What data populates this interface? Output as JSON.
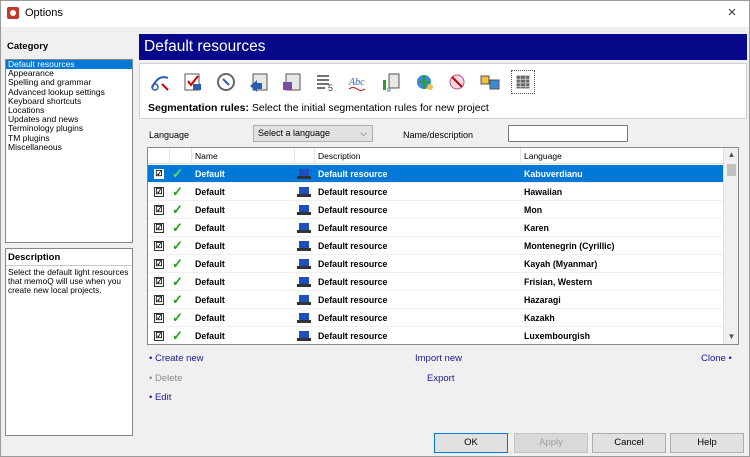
{
  "window": {
    "title": "Options",
    "close_label": "×"
  },
  "category": {
    "label": "Category",
    "items": [
      "Default resources",
      "Appearance",
      "Spelling and grammar",
      "Advanced lookup settings",
      "Keyboard shortcuts",
      "Locations",
      "Updates and news",
      "Terminology plugins",
      "TM plugins",
      "Miscellaneous"
    ],
    "selected_index": 0
  },
  "description": {
    "title": "Description",
    "text": "Select the default light resources that memoQ will use when you create new local projects."
  },
  "main": {
    "header": "Default resources",
    "toolbar_icons": [
      "autocorrect-icon",
      "autotranslation-rules-icon",
      "ignore-lists-icon",
      "export-path-rules-icon",
      "filter-config-icon",
      "font-substitution-icon",
      "spelling-icon",
      "keyboard-shortcuts-icon",
      "lqa-icon",
      "non-translatables-icon",
      "qa-settings-icon",
      "segmentation-rules-icon"
    ],
    "active_icon_index": 11,
    "segmentation_label": "Segmentation rules:",
    "segmentation_text": "Select the initial segmentation rules for new project"
  },
  "filters": {
    "language_label": "Language",
    "language_select": "Select a language",
    "name_label": "Name/description",
    "name_value": ""
  },
  "grid": {
    "columns": [
      "Name",
      "Description",
      "Language"
    ],
    "check_mark": "☑",
    "tick_mark": "✓",
    "rows": [
      {
        "name": "Default",
        "description": "Default resource",
        "language": "Kabuverdianu"
      },
      {
        "name": "Default",
        "description": "Default resource",
        "language": "Hawaiian"
      },
      {
        "name": "Default",
        "description": "Default resource",
        "language": "Mon"
      },
      {
        "name": "Default",
        "description": "Default resource",
        "language": "Karen"
      },
      {
        "name": "Default",
        "description": "Default resource",
        "language": "Montenegrin (Cyrillic)"
      },
      {
        "name": "Default",
        "description": "Default resource",
        "language": "Kayah (Myanmar)"
      },
      {
        "name": "Default",
        "description": "Default resource",
        "language": "Frisian, Western"
      },
      {
        "name": "Default",
        "description": "Default resource",
        "language": "Hazaragi"
      },
      {
        "name": "Default",
        "description": "Default resource",
        "language": "Kazakh"
      },
      {
        "name": "Default",
        "description": "Default resource",
        "language": "Luxembourgish"
      }
    ],
    "selected_index": 0
  },
  "actions": {
    "create_new": "• Create new",
    "delete": "• Delete",
    "edit": "• Edit",
    "import_new": "Import new",
    "export": "Export",
    "clone": "Clone •"
  },
  "buttons": {
    "ok": "OK",
    "apply": "Apply",
    "cancel": "Cancel",
    "help": "Help"
  },
  "colors": {
    "header_bg": "#08088a",
    "selection": "#0078d7",
    "link": "#1a1a9a",
    "tick": "#1f9d1f"
  }
}
